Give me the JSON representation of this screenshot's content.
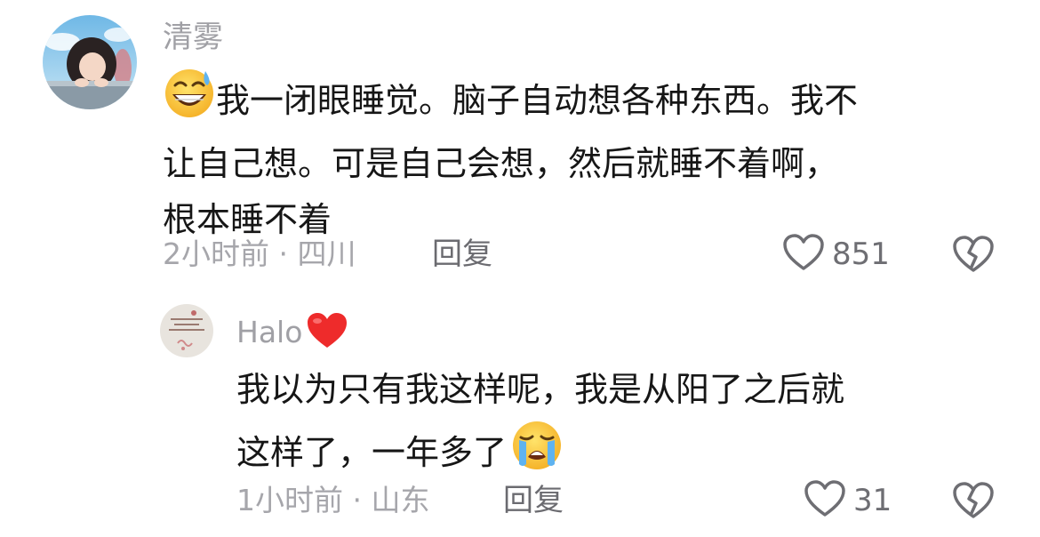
{
  "comments": [
    {
      "username": "清雾",
      "text_line1": "我一闭眼睡觉。脑子自动想各种东西。我不",
      "text_line2": "让自己想。可是自己会想，然后就睡不着啊，",
      "text_line3": "根本睡不着",
      "leading_emoji": "grinning-sweat-face",
      "meta": "2小时前 · 四川",
      "reply_label": "回复",
      "likes": "851"
    },
    {
      "username": "Halo",
      "username_emoji": "red-heart",
      "text_line1": "我以为只有我这样呢，我是从阳了之后就",
      "text_line2": "这样了，一年多了",
      "trailing_emoji": "loudly-crying-face",
      "meta": "1小时前 · 山东",
      "reply_label": "回复",
      "likes": "31"
    }
  ],
  "colors": {
    "username": "#a0a0a5",
    "body_text": "#161616",
    "meta_text": "#a6a6ab",
    "reply_text": "#6b6b70",
    "icon_stroke": "#6e6e73"
  }
}
